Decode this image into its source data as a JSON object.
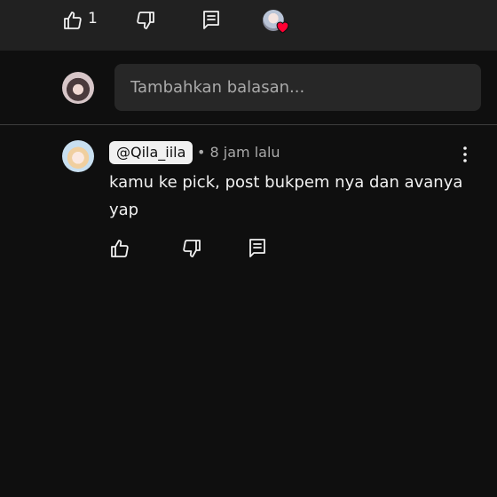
{
  "top_actions": {
    "like_count": "1"
  },
  "reply": {
    "placeholder": "Tambahkan balasan..."
  },
  "comment": {
    "handle": "@Qila_iila",
    "meta": "• 8 jam lalu",
    "text": "kamu ke pick, post bukpem nya dan avanya yap"
  },
  "colors": {
    "background": "#0f0f0f",
    "top_bar": "#212121",
    "input": "#272727",
    "heart": "#ff0033"
  },
  "icons": [
    "thumb-up-icon",
    "thumb-down-icon",
    "reply-icon",
    "heart-icon",
    "more-vert-icon"
  ]
}
